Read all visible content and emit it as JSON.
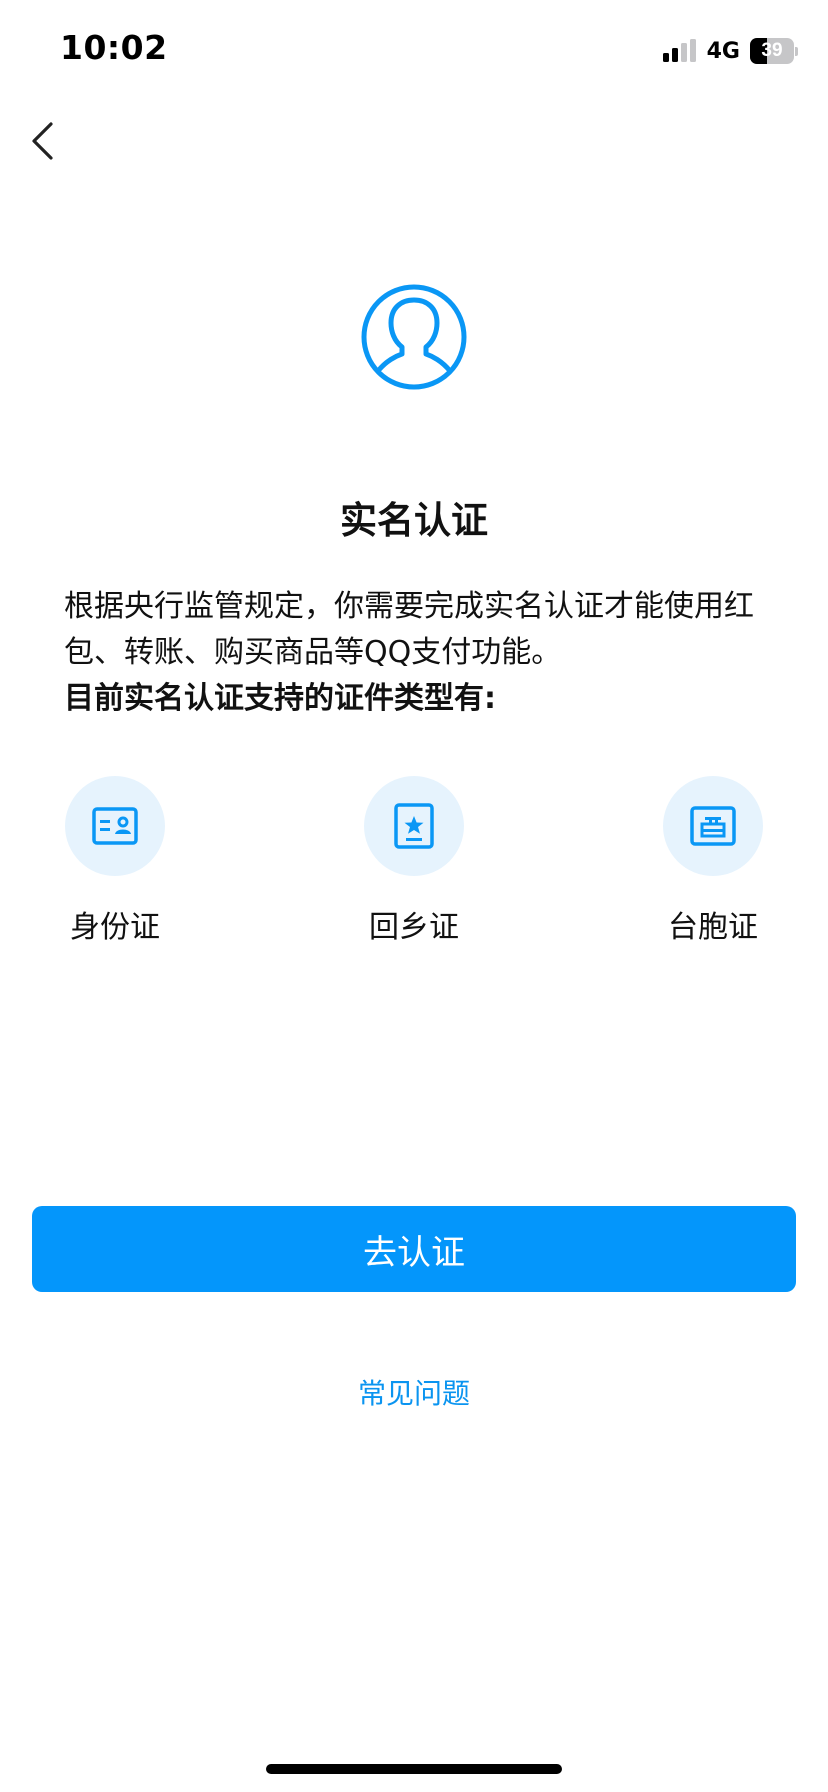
{
  "status_bar": {
    "time": "10:02",
    "network": "4G",
    "battery": "39",
    "battery_level": 0.39
  },
  "header": {
    "back_icon": "chevron-left-icon"
  },
  "hero": {
    "icon": "user-avatar-icon",
    "title": "实名认证"
  },
  "description": {
    "line1": "根据央行监管规定，你需要完成实名认证才能使用红包、转账、购买商品等QQ支付功能。",
    "line2": "目前实名认证支持的证件类型有:"
  },
  "doc_types": [
    {
      "label": "身份证",
      "icon": "id-card-icon"
    },
    {
      "label": "回乡证",
      "icon": "home-return-permit-icon"
    },
    {
      "label": "台胞证",
      "icon": "taiwan-compatriot-permit-icon"
    }
  ],
  "actions": {
    "primary_label": "去认证",
    "faq_label": "常见问题"
  },
  "colors": {
    "accent": "#0496fb",
    "link": "#0a94f0",
    "icon_bg": "#e6f3fd"
  }
}
